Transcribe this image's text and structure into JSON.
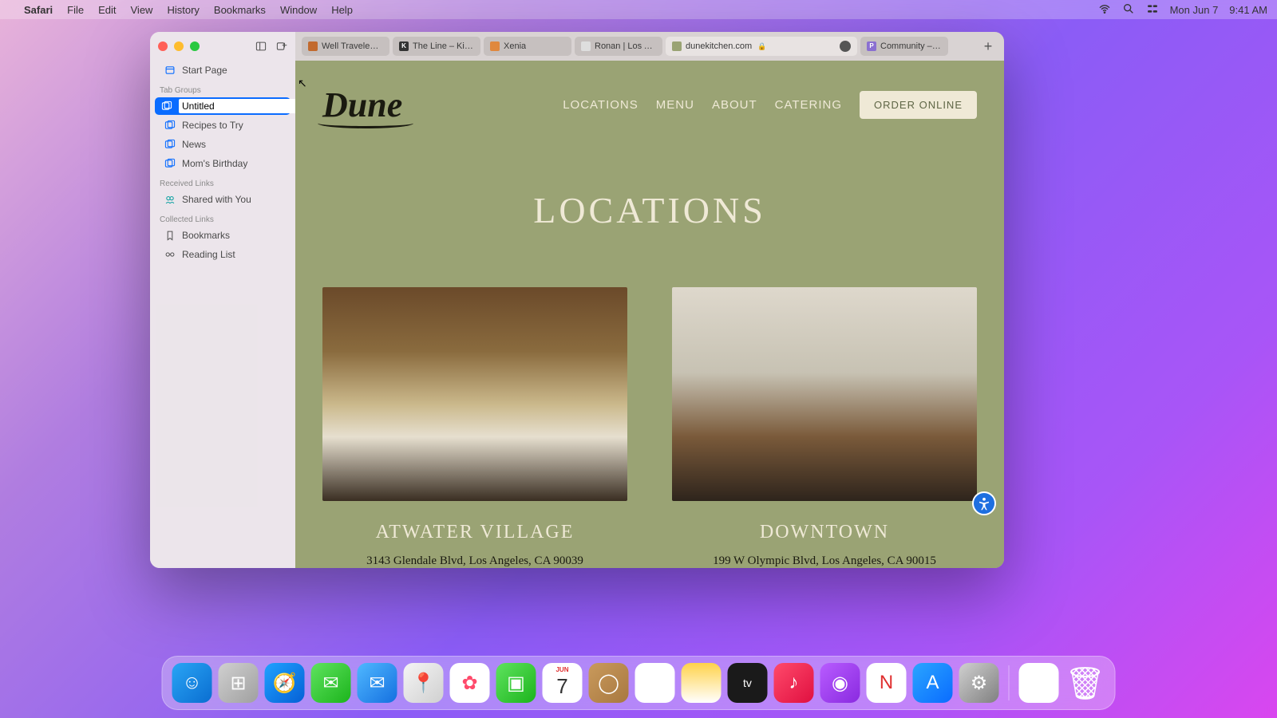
{
  "menubar": {
    "app": "Safari",
    "items": [
      "File",
      "Edit",
      "View",
      "History",
      "Bookmarks",
      "Window",
      "Help"
    ],
    "date": "Mon Jun 7",
    "time": "9:41 AM"
  },
  "traffic_colors": {
    "close": "#ff5f57",
    "min": "#febc2e",
    "max": "#28c840"
  },
  "sidebar": {
    "start_page": "Start Page",
    "section_tabgroups": "Tab Groups",
    "editing_value": "Untitled",
    "tab_groups": [
      "Recipes to Try",
      "News",
      "Mom's Birthday"
    ],
    "section_received": "Received Links",
    "shared_with_you": "Shared with You",
    "section_collected": "Collected Links",
    "bookmarks": "Bookmarks",
    "reading_list": "Reading List"
  },
  "tabs": [
    {
      "label": "Well Traveled |…",
      "favicon": "#c26a2e"
    },
    {
      "label": "The Line – Kinfolk",
      "favicon": "#333",
      "faviconText": "K"
    },
    {
      "label": "Xenia",
      "favicon": "#e0883e"
    },
    {
      "label": "Ronan | Los Ang…",
      "favicon": "#dedede"
    },
    {
      "label": "dunekitchen.com",
      "favicon": "#9aa374",
      "active": true,
      "reader": true
    },
    {
      "label": "Community – Pi…",
      "favicon": "#8a6fd1",
      "faviconText": "P"
    }
  ],
  "site": {
    "logo": "Dune",
    "nav": [
      "LOCATIONS",
      "MENU",
      "ABOUT",
      "CATERING"
    ],
    "order_btn": "ORDER ONLINE",
    "heading": "LOCATIONS",
    "locations": [
      {
        "name": "ATWATER VILLAGE",
        "address": "3143 Glendale Blvd, Los Angeles, CA 90039"
      },
      {
        "name": "DOWNTOWN",
        "address": "199 W Olympic Blvd, Los Angeles, CA 90015"
      }
    ]
  },
  "dock": [
    {
      "name": "finder",
      "bg": "linear-gradient(135deg,#2aa5f5,#0a6ed1)",
      "glyph": "☺"
    },
    {
      "name": "launchpad",
      "bg": "linear-gradient(135deg,#d0d0d0,#a0a0a0)",
      "glyph": "⊞"
    },
    {
      "name": "safari",
      "bg": "linear-gradient(135deg,#1fa2ff,#0560d6)",
      "glyph": "🧭"
    },
    {
      "name": "messages",
      "bg": "linear-gradient(135deg,#5fe35f,#1cb41c)",
      "glyph": "✉"
    },
    {
      "name": "mail",
      "bg": "linear-gradient(135deg,#4fb8ff,#1570e0)",
      "glyph": "✉"
    },
    {
      "name": "maps",
      "bg": "linear-gradient(135deg,#f5f5f5,#d0d0d0)",
      "glyph": "📍"
    },
    {
      "name": "photos",
      "bg": "#ffffff",
      "glyph": "✿"
    },
    {
      "name": "facetime",
      "bg": "linear-gradient(135deg,#5fe35f,#1cb41c)",
      "glyph": "▣"
    },
    {
      "name": "calendar",
      "bg": "#ffffff",
      "glyph": "7",
      "top": "JUN"
    },
    {
      "name": "contacts",
      "bg": "linear-gradient(135deg,#c99a5c,#a87840)",
      "glyph": "◯"
    },
    {
      "name": "reminders",
      "bg": "#ffffff",
      "glyph": "☰"
    },
    {
      "name": "notes",
      "bg": "linear-gradient(180deg,#ffd24a,#ffffff)",
      "glyph": ""
    },
    {
      "name": "tv",
      "bg": "#1a1a1a",
      "glyph": "tv"
    },
    {
      "name": "music",
      "bg": "linear-gradient(135deg,#ff4a6b,#e01040)",
      "glyph": "♪"
    },
    {
      "name": "podcasts",
      "bg": "linear-gradient(135deg,#b85cff,#8a2ae0)",
      "glyph": "◉"
    },
    {
      "name": "news",
      "bg": "#ffffff",
      "glyph": "N"
    },
    {
      "name": "appstore",
      "bg": "linear-gradient(135deg,#2aa5ff,#0a6cff)",
      "glyph": "A"
    },
    {
      "name": "settings",
      "bg": "linear-gradient(135deg,#d0d0d0,#808080)",
      "glyph": "⚙"
    }
  ],
  "dock_right": [
    {
      "name": "downloads",
      "bg": "#ffffff",
      "glyph": "▭"
    },
    {
      "name": "trash",
      "bg": "transparent",
      "glyph": "🗑"
    }
  ]
}
